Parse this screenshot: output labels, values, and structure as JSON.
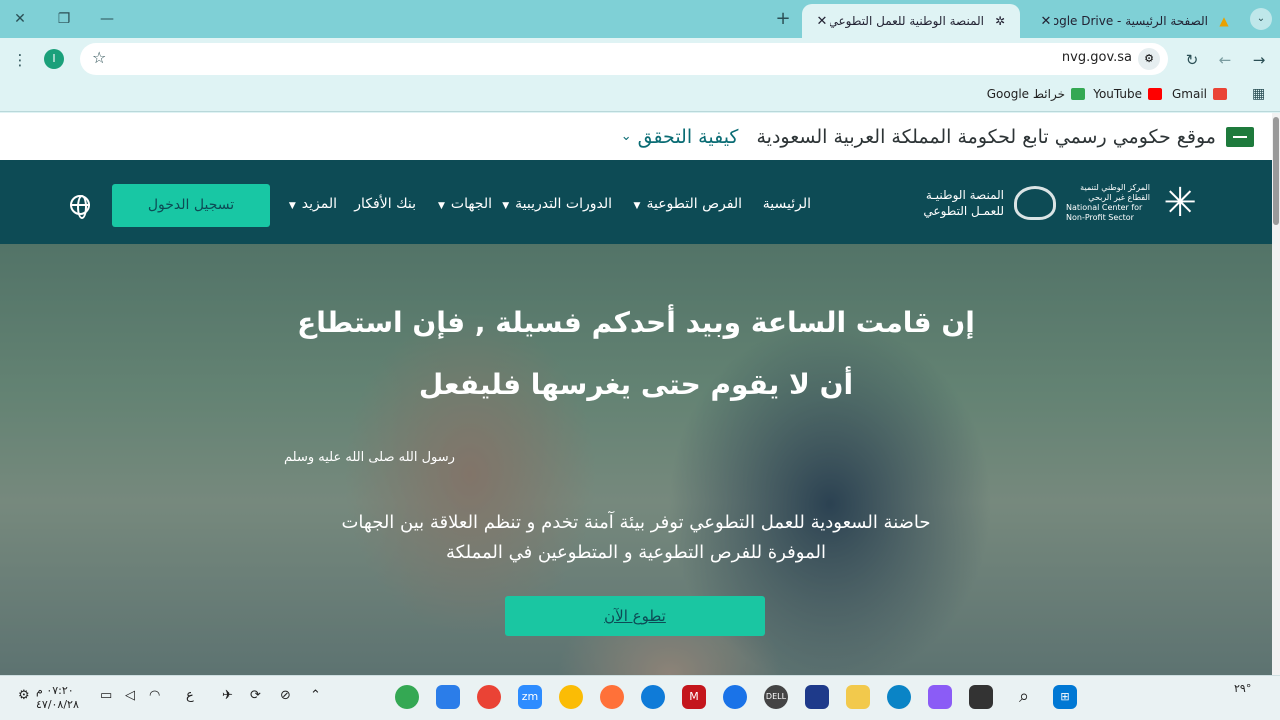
{
  "browser": {
    "tabs": [
      {
        "title": "الصفحة الرئيسية - Google Drive",
        "favicon": "google-drive-icon",
        "active": false
      },
      {
        "title": "المنصة الوطنية للعمل التطوعي",
        "favicon": "nvg-icon",
        "active": true
      }
    ],
    "url": "nvg.gov.sa",
    "profile_initial": "I",
    "bookmarks": [
      "Gmail",
      "YouTube",
      "خرائط Google"
    ]
  },
  "page": {
    "gov_banner": {
      "text": "موقع حكومي رسمي تابع لحكومة المملكة العربية السعودية",
      "verify": "كيفية التحقق"
    },
    "logo": {
      "ncnp_ar": "المركز الوطني لتنمية القطاع غير الربحي",
      "ncnp_en": "National Center for Non-Profit Sector",
      "nvg_line1": "المنصة الوطنيـة",
      "nvg_line2": "للعمـل التطوعي"
    },
    "nav": {
      "home": "الرئيسية",
      "opportunities": "الفرص التطوعية",
      "courses": "الدورات التدريبية",
      "entities": "الجهات",
      "ideas_bank": "بنك الأفكار",
      "more": "المزيد",
      "login": "تسجيل الدخول"
    },
    "hero": {
      "line1": "إن قامت الساعة وبيد أحدكم فسيلة , فإن استطاع",
      "line2": "أن لا يقوم حتى يغرسها فليفعل",
      "source": "رسول الله صلى الله عليه وسلم",
      "desc1": "حاضنة السعودية للعمل التطوعي توفر بيئة آمنة تخدم و تنظم العلاقة بين الجهات",
      "desc2": "الموفرة للفرص التطوعية و المتطوعين في المملكة",
      "cta": "تطوع الآن"
    }
  },
  "taskbar": {
    "clock_time": "٠٧:٢٠ م",
    "clock_date": "٤٧/٠٨/٢٨",
    "lang": "ع",
    "weather": "٢٩°"
  },
  "colors": {
    "accent": "#18c7a4",
    "nav_bg": "#0d4b55",
    "tabstrip": "#7fd0d6"
  }
}
